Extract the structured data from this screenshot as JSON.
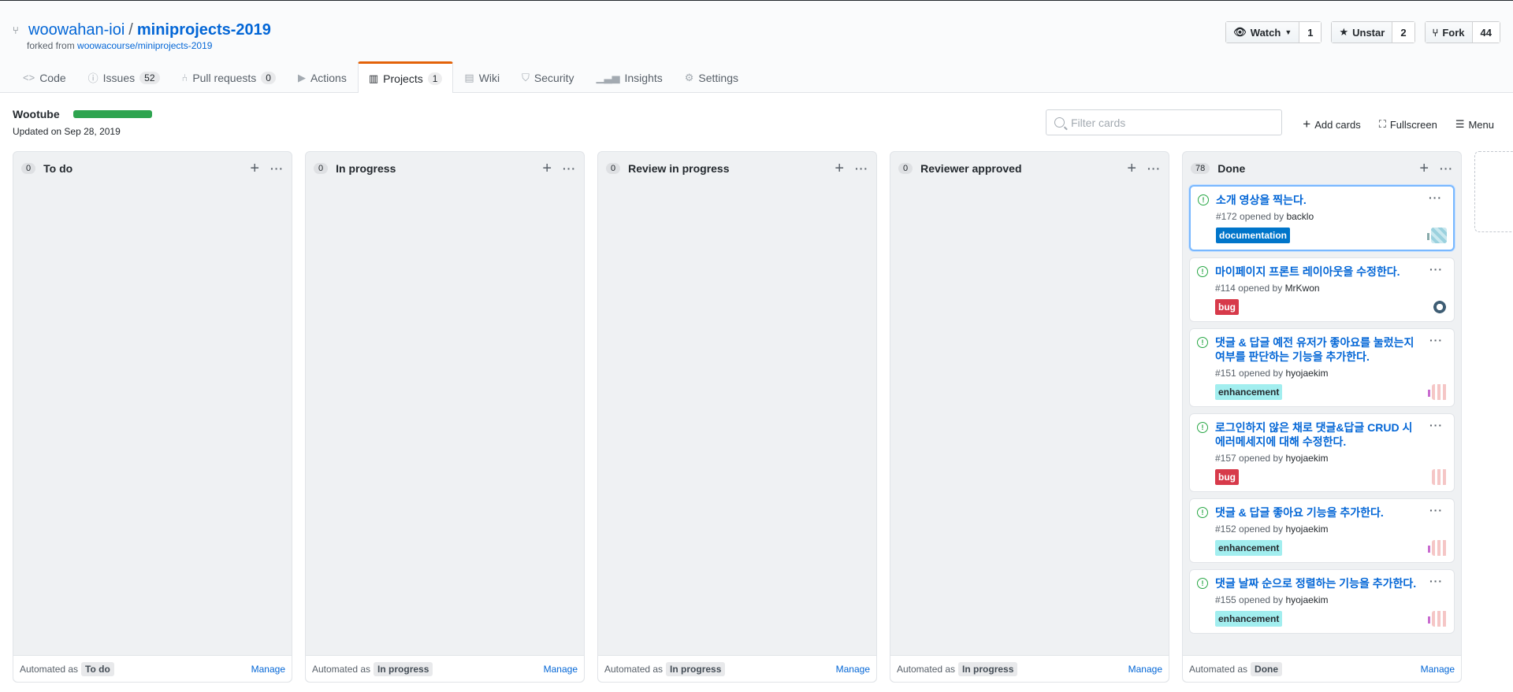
{
  "repo": {
    "owner": "woowahan-ioi",
    "separator": "/",
    "name": "miniprojects-2019",
    "forked_prefix": "forked from",
    "forked_from": "woowacourse/miniprojects-2019"
  },
  "header_buttons": {
    "watch_label": "Watch",
    "watch_count": "1",
    "star_label": "Unstar",
    "star_count": "2",
    "fork_label": "Fork",
    "fork_count": "44"
  },
  "tabs": [
    {
      "label": "Code",
      "icon": "code-icon"
    },
    {
      "label": "Issues",
      "icon": "issue-icon",
      "count": "52"
    },
    {
      "label": "Pull requests",
      "icon": "pull-request-icon",
      "count": "0"
    },
    {
      "label": "Actions",
      "icon": "play-icon"
    },
    {
      "label": "Projects",
      "icon": "project-icon",
      "count": "1",
      "selected": true
    },
    {
      "label": "Wiki",
      "icon": "book-icon"
    },
    {
      "label": "Security",
      "icon": "shield-icon"
    },
    {
      "label": "Insights",
      "icon": "graph-icon"
    },
    {
      "label": "Settings",
      "icon": "gear-icon"
    }
  ],
  "project": {
    "name": "Wootube",
    "progress": 1.0,
    "updated": "Updated on Sep 28, 2019",
    "filter_placeholder": "Filter cards",
    "add_cards": "Add cards",
    "fullscreen": "Fullscreen",
    "menu": "Menu"
  },
  "colors": {
    "accent": "#0366d6",
    "progress": "#2ea44f",
    "tab_active": "#e36209"
  },
  "footer_text": {
    "automated_as": "Automated as",
    "manage": "Manage"
  },
  "columns": [
    {
      "count": "0",
      "title": "To do",
      "automation": "To do"
    },
    {
      "count": "0",
      "title": "In progress",
      "automation": "In progress"
    },
    {
      "count": "0",
      "title": "Review in progress",
      "automation": "In progress"
    },
    {
      "count": "0",
      "title": "Reviewer approved",
      "automation": "In progress"
    },
    {
      "count": "78",
      "title": "Done",
      "automation": "Done"
    }
  ],
  "done_cards": [
    {
      "title": "소개 영상을 찍는다.",
      "number": "#172",
      "opened_by": "opened by",
      "author": "backlo",
      "label": "documentation",
      "label_color": "#0075ca",
      "label_text": "#ffffff",
      "avatar": "a"
    },
    {
      "title": "마이페이지 프론트 레이아웃을 수정한다.",
      "number": "#114",
      "opened_by": "opened by",
      "author": "MrKwon",
      "label": "bug",
      "label_color": "#d73a4a",
      "label_text": "#ffffff",
      "avatar": "b"
    },
    {
      "title": "댓글 & 답글 예전 유저가 좋아요를 눌렀는지 여부를 판단하는 기능을 추가한다.",
      "number": "#151",
      "opened_by": "opened by",
      "author": "hyojaekim",
      "label": "enhancement",
      "label_color": "#a2eeef",
      "label_text": "#24292e",
      "avatar": "c"
    },
    {
      "title": "로그인하지 않은 채로 댓글&답글 CRUD 시 에러메세지에 대해 수정한다.",
      "number": "#157",
      "opened_by": "opened by",
      "author": "hyojaekim",
      "label": "bug",
      "label_color": "#d73a4a",
      "label_text": "#ffffff",
      "avatar": "c"
    },
    {
      "title": "댓글 & 답글 좋아요 기능을 추가한다.",
      "number": "#152",
      "opened_by": "opened by",
      "author": "hyojaekim",
      "label": "enhancement",
      "label_color": "#a2eeef",
      "label_text": "#24292e",
      "avatar": "c"
    },
    {
      "title": "댓글 날짜 순으로 정렬하는 기능을 추가한다.",
      "number": "#155",
      "opened_by": "opened by",
      "author": "hyojaekim",
      "label": "enhancement",
      "label_color": "#a2eeef",
      "label_text": "#24292e",
      "avatar": "c"
    }
  ]
}
